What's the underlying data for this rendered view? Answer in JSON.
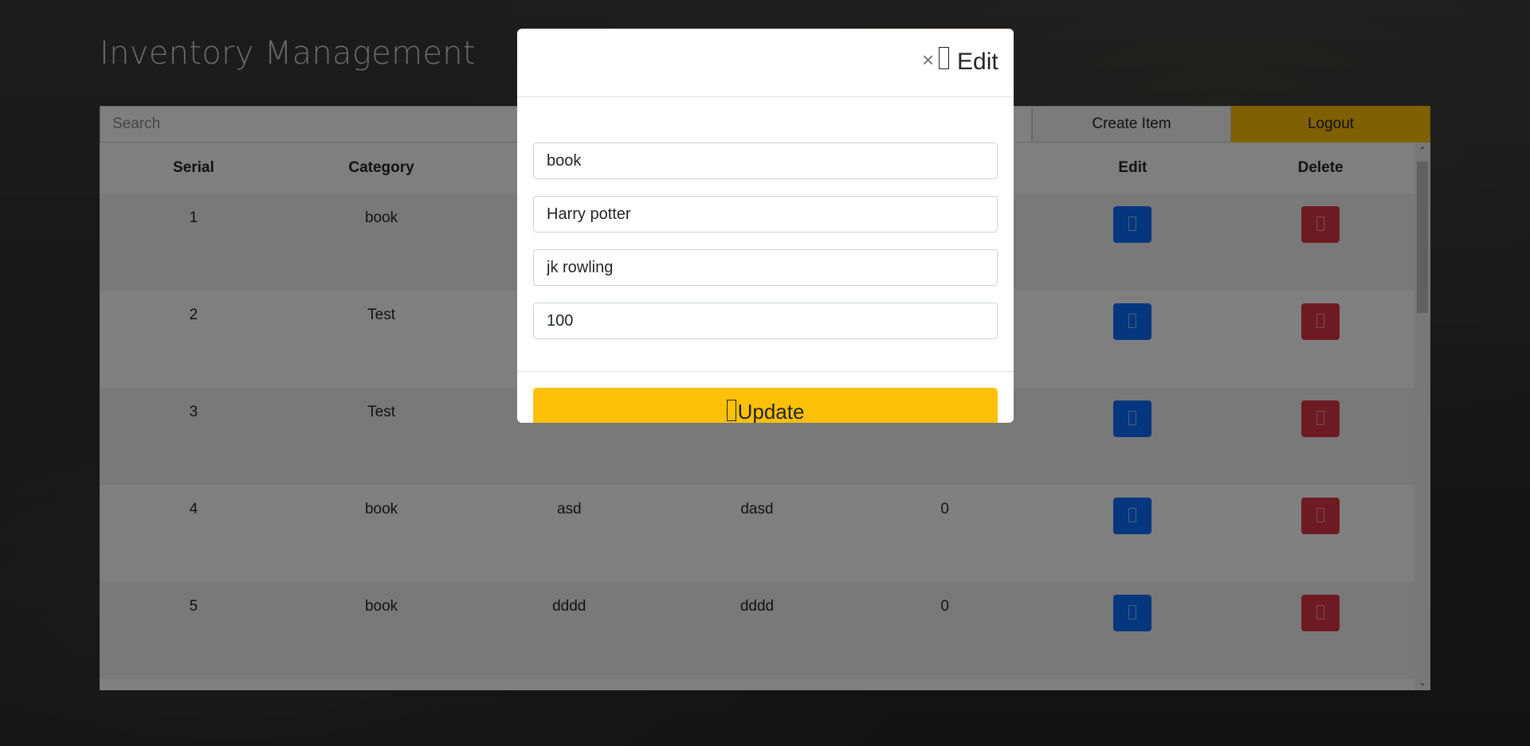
{
  "page": {
    "title": "Inventory Management"
  },
  "toolbar": {
    "search_placeholder": "Search",
    "create_label": "Create Item",
    "logout_label": "Logout"
  },
  "table": {
    "headers": [
      "Serial",
      "Category",
      "",
      "",
      "",
      "Edit",
      "Delete"
    ],
    "rows": [
      {
        "serial": "1",
        "category": "book",
        "c3": "",
        "c4": "",
        "c5": ""
      },
      {
        "serial": "2",
        "category": "Test",
        "c3": "",
        "c4": "",
        "c5": ""
      },
      {
        "serial": "3",
        "category": "Test",
        "c3": "",
        "c4": "",
        "c5": ""
      },
      {
        "serial": "4",
        "category": "book",
        "c3": "asd",
        "c4": "dasd",
        "c5": "0"
      },
      {
        "serial": "5",
        "category": "book",
        "c3": "dddd",
        "c4": "dddd",
        "c5": "0"
      }
    ]
  },
  "modal": {
    "title": "Edit",
    "close_symbol": "×",
    "fields": {
      "category": "book",
      "name": "Harry potter",
      "author": "jk rowling",
      "quantity": "100"
    },
    "submit_label": "Update"
  },
  "colors": {
    "accent_yellow": "#ffc107",
    "edit_blue": "#0d6efd",
    "delete_red": "#dc3545"
  }
}
